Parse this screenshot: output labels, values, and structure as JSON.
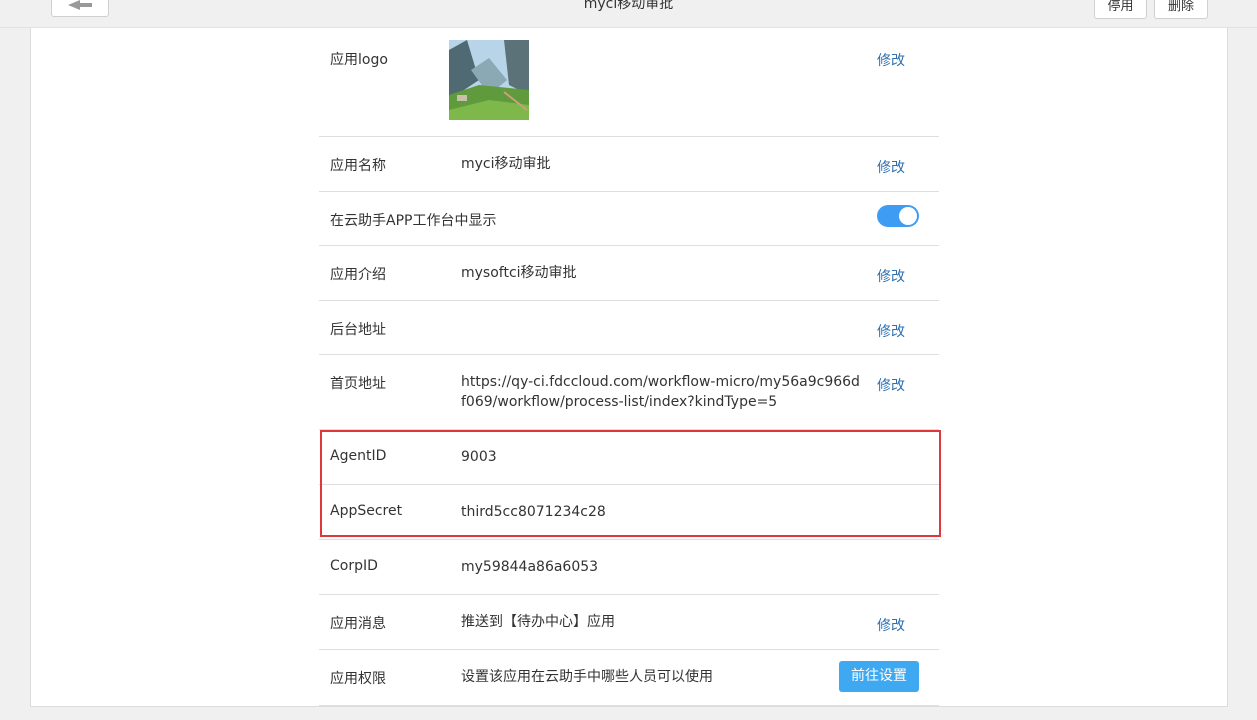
{
  "header": {
    "title": "myci移动审批",
    "disable_label": "停用",
    "delete_label": "删除"
  },
  "rows": {
    "logo": {
      "label": "应用logo",
      "edit": "修改"
    },
    "name": {
      "label": "应用名称",
      "value": "myci移动审批",
      "edit": "修改"
    },
    "show_in_app": {
      "label": "在云助手APP工作台中显示",
      "enabled": true
    },
    "intro": {
      "label": "应用介绍",
      "value": "mysoftci移动审批",
      "edit": "修改"
    },
    "backend": {
      "label": "后台地址",
      "value": "",
      "edit": "修改"
    },
    "homepage": {
      "label": "首页地址",
      "value_line1": "https://qy-ci.fdccloud.com/workflow-micro/my56a9c966d",
      "value_line2": "f069/workflow/process-list/index?kindType=5",
      "edit": "修改"
    },
    "agent_id": {
      "label": "AgentID",
      "value": "9003"
    },
    "app_secret": {
      "label": "AppSecret",
      "value": "third5cc8071234c28"
    },
    "corp_id": {
      "label": "CorpID",
      "value": "my59844a86a6053"
    },
    "message": {
      "label": "应用消息",
      "value": "推送到【待办中心】应用",
      "edit": "修改"
    },
    "permission": {
      "label": "应用权限",
      "value": "设置该应用在云助手中哪些人员可以使用",
      "button": "前往设置"
    }
  },
  "colors": {
    "accent": "#3e9df2",
    "link": "#2f6fb0",
    "highlight": "#e0373c"
  }
}
